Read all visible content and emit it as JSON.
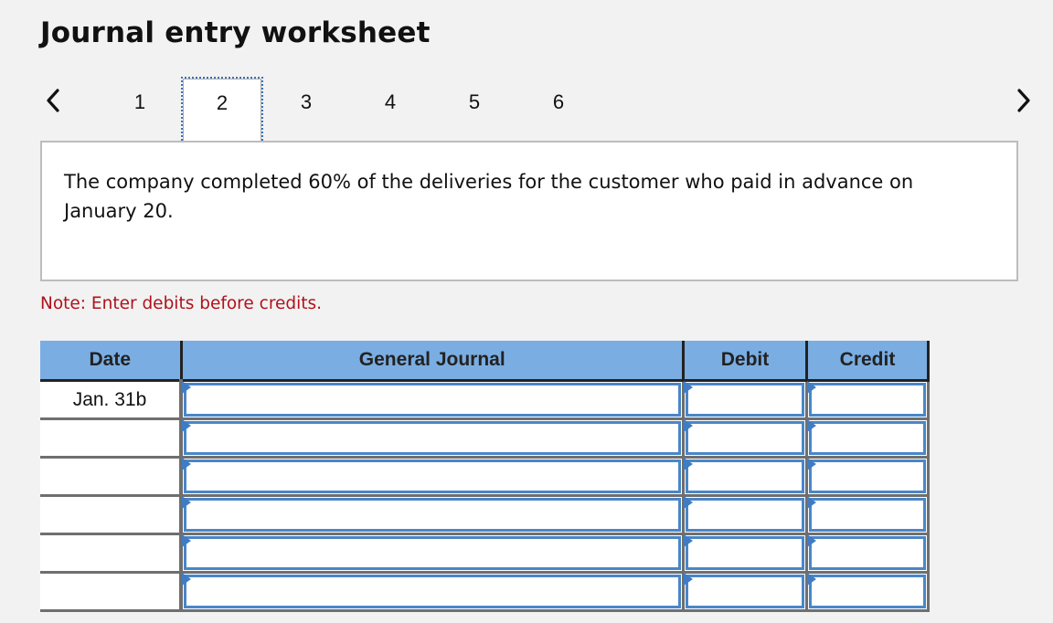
{
  "header": {
    "title": "Journal entry worksheet"
  },
  "pagination": {
    "prev_icon": "chevron-left-icon",
    "next_icon": "chevron-right-icon",
    "steps": [
      "1",
      "2",
      "3",
      "4",
      "5",
      "6"
    ],
    "active_step": "2"
  },
  "transaction": {
    "description": "The company completed 60% of the deliveries for the customer who paid in advance on January 20."
  },
  "note": "Note: Enter debits before credits.",
  "journal": {
    "columns": {
      "date": "Date",
      "account": "General Journal",
      "debit": "Debit",
      "credit": "Credit"
    },
    "rows": [
      {
        "date": "Jan. 31b",
        "account": "",
        "debit": "",
        "credit": ""
      },
      {
        "date": "",
        "account": "",
        "debit": "",
        "credit": ""
      },
      {
        "date": "",
        "account": "",
        "debit": "",
        "credit": ""
      },
      {
        "date": "",
        "account": "",
        "debit": "",
        "credit": ""
      },
      {
        "date": "",
        "account": "",
        "debit": "",
        "credit": ""
      },
      {
        "date": "",
        "account": "",
        "debit": "",
        "credit": ""
      }
    ]
  },
  "colors": {
    "header_bg": "#7aade2",
    "input_border": "#4a86c8",
    "note_text": "#b0121b",
    "active_step_border": "#3f6fb5"
  }
}
